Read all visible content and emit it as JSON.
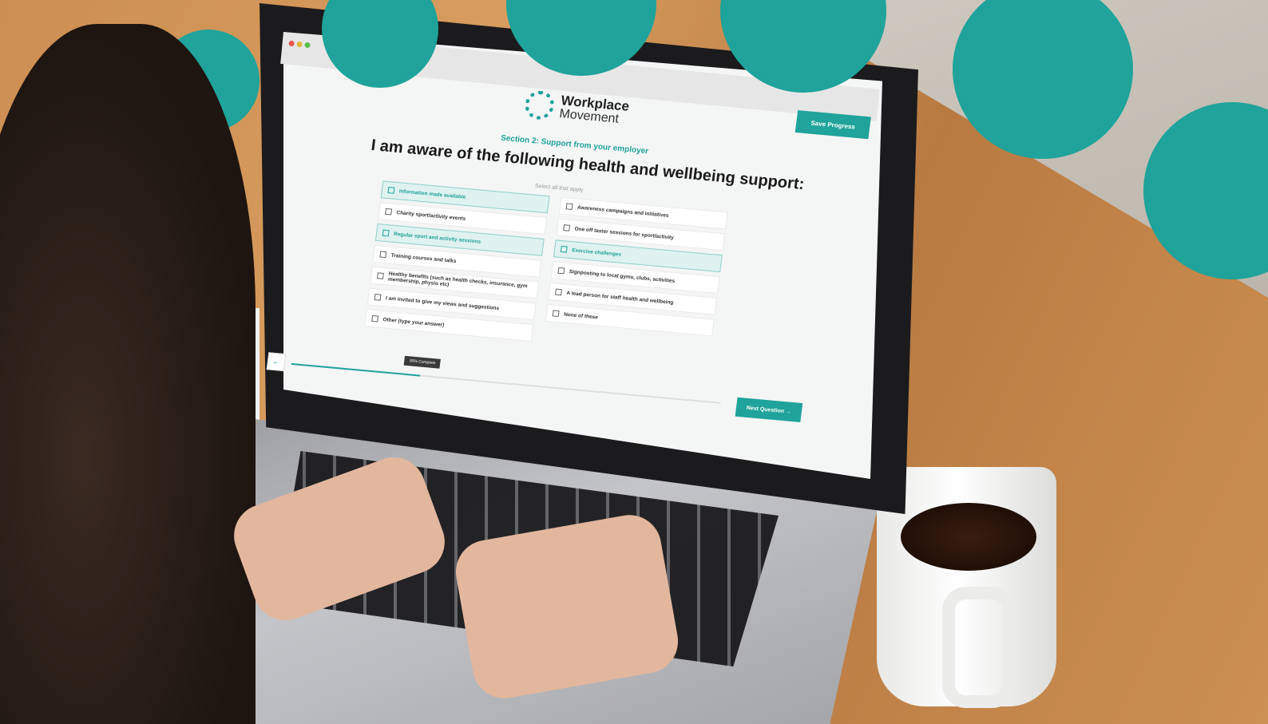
{
  "app": {
    "logo_line1": "Workplace",
    "logo_line2": "Movement",
    "save_label": "Save Progress"
  },
  "survey": {
    "section": "Section 2: Support from your employer",
    "question": "I am aware of the following health and wellbeing support:",
    "hint": "Select all that apply",
    "options": [
      {
        "label": "Information made available",
        "selected": true
      },
      {
        "label": "Awareness campaigns and initiatives",
        "selected": false
      },
      {
        "label": "Charity sport/activity events",
        "selected": false
      },
      {
        "label": "One off taster sessions for sport/activity",
        "selected": false
      },
      {
        "label": "Regular sport and activity sessions",
        "selected": true
      },
      {
        "label": "Exercise challenges",
        "selected": true
      },
      {
        "label": "Training courses and talks",
        "selected": false
      },
      {
        "label": "Signposting to local gyms, clubs, activities",
        "selected": false
      },
      {
        "label": "Healthy benefits (such as health checks, insurance, gym membership, physio etc)",
        "selected": false
      },
      {
        "label": "A lead person for staff health and wellbeing",
        "selected": false
      },
      {
        "label": "I am invited to give my views and suggestions",
        "selected": false
      },
      {
        "label": "None of these",
        "selected": false
      },
      {
        "label": "Other (type your answer)",
        "selected": false
      }
    ]
  },
  "progress": {
    "percent": 30,
    "label": "30% Complete"
  },
  "nav": {
    "back_icon": "arrow-left-icon",
    "next_label": "Next Question",
    "next_icon": "arrow-right-icon"
  },
  "colors": {
    "accent": "#1fa39a",
    "selected_bg": "#dff2f0"
  }
}
